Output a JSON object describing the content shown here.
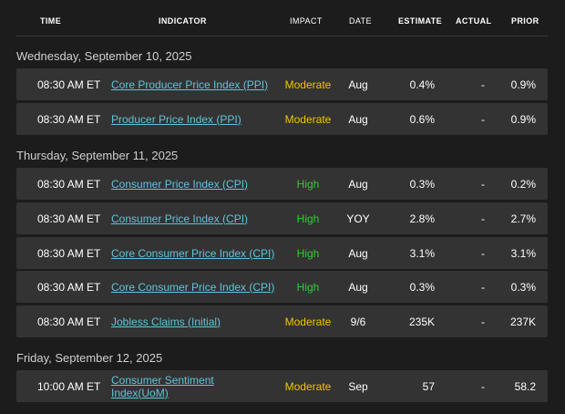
{
  "columns": {
    "time": "TIME",
    "indicator": "INDICATOR",
    "impact": "IMPACT",
    "date": "DATE",
    "estimate": "ESTIMATE",
    "actual": "ACTUAL",
    "prior": "PRIOR"
  },
  "days": [
    {
      "heading": "Wednesday, September 10, 2025",
      "events": [
        {
          "time": "08:30 AM ET",
          "indicator": "Core Producer Price Index (PPI)",
          "impact": "Moderate",
          "date": "Aug",
          "estimate": "0.4%",
          "actual": "-",
          "prior": "0.9%"
        },
        {
          "time": "08:30 AM ET",
          "indicator": "Producer Price Index (PPI)",
          "impact": "Moderate",
          "date": "Aug",
          "estimate": "0.6%",
          "actual": "-",
          "prior": "0.9%"
        }
      ]
    },
    {
      "heading": "Thursday, September 11, 2025",
      "events": [
        {
          "time": "08:30 AM ET",
          "indicator": "Consumer Price Index (CPI)",
          "impact": "High",
          "date": "Aug",
          "estimate": "0.3%",
          "actual": "-",
          "prior": "0.2%"
        },
        {
          "time": "08:30 AM ET",
          "indicator": "Consumer Price Index (CPI)",
          "impact": "High",
          "date": "YOY",
          "estimate": "2.8%",
          "actual": "-",
          "prior": "2.7%"
        },
        {
          "time": "08:30 AM ET",
          "indicator": "Core Consumer Price Index (CPI)",
          "impact": "High",
          "date": "Aug",
          "estimate": "3.1%",
          "actual": "-",
          "prior": "3.1%"
        },
        {
          "time": "08:30 AM ET",
          "indicator": "Core Consumer Price Index (CPI)",
          "impact": "High",
          "date": "Aug",
          "estimate": "0.3%",
          "actual": "-",
          "prior": "0.3%"
        },
        {
          "time": "08:30 AM ET",
          "indicator": "Jobless Claims (Initial)",
          "impact": "Moderate",
          "date": "9/6",
          "estimate": "235K",
          "actual": "-",
          "prior": "237K"
        }
      ]
    },
    {
      "heading": "Friday, September 12, 2025",
      "events": [
        {
          "time": "10:00 AM ET",
          "indicator": "Consumer Sentiment Index(UoM)",
          "impact": "Moderate",
          "date": "Sep",
          "estimate": "57",
          "actual": "-",
          "prior": "58.2"
        }
      ]
    }
  ],
  "colors": {
    "high": "#33cc33",
    "moderate": "#f2c400",
    "link": "#5fc4d8"
  }
}
